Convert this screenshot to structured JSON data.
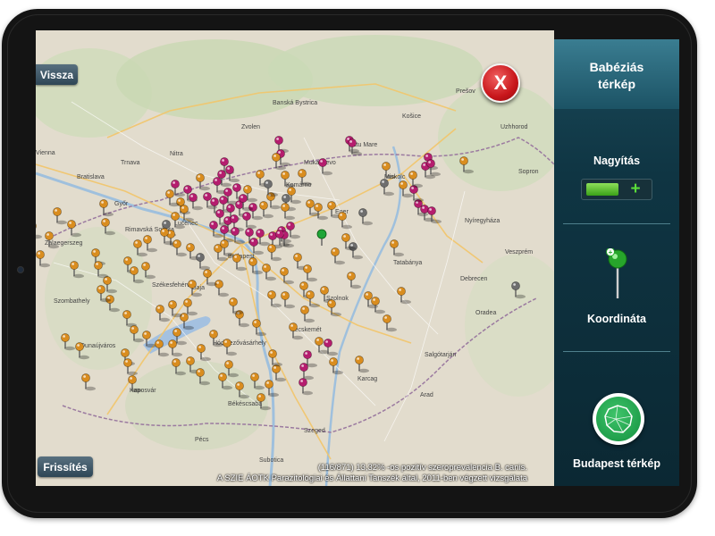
{
  "map": {
    "back_label": "Vissza",
    "refresh_label": "Frissítés",
    "close_label": "X",
    "caption_line1": "(116/871) 13,32% -os pozitív szeroprevalencia B. canis.",
    "caption_line2": "A SZIE ÁOTK Parazitológiai és Állattani Tanszék által, 2011-ben végzett vizsgálata",
    "pin_colors": {
      "positive": "#b51d6e",
      "negative": "#d98d1f",
      "unknown": "#6e6e6e",
      "selected": "#1fa537"
    },
    "places": [
      "Vienna",
      "Bratislava",
      "Győr",
      "Budapest",
      "Miskolc",
      "Košice",
      "Debrecen",
      "Nyíregyháza",
      "Eger",
      "Szolnok",
      "Kecskemét",
      "Szeged",
      "Pécs",
      "Kaposvár",
      "Szombathely",
      "Nitra",
      "Zvolen",
      "Trnava",
      "Banská Bystrica",
      "Prešov",
      "Oradea",
      "Subotica",
      "Arad",
      "Uzhhorod",
      "Sopron",
      "Veszprém",
      "Zalaegerszeg",
      "Székesfehérvár",
      "Dunaújváros",
      "Baja",
      "Hódmezővásárhely",
      "Békéscsaba",
      "Karcag",
      "Salgótarján",
      "Tatabánya",
      "Komárno",
      "Lučenec",
      "Rimavská Sobota",
      "Mukachevo",
      "Satu Mare"
    ]
  },
  "sidebar": {
    "title": "Babéziás\ntérkép",
    "zoom_label": "Nagyítás",
    "zoom_plus": "+",
    "coord_label": "Koordináta",
    "budapest_label": "Budapest térkép"
  }
}
